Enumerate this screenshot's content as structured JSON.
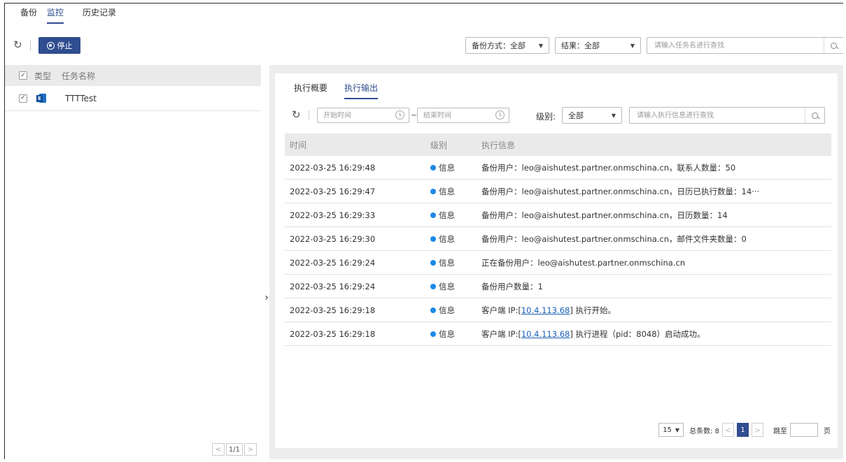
{
  "top_nav": {
    "tabs": [
      "备份",
      "监控",
      "历史记录"
    ],
    "active": "监控"
  },
  "toolbar": {
    "stop_label": "停止",
    "backup_method_filter": "备份方式：全部",
    "result_filter": "结果：全部",
    "task_search_placeholder": "请输入任务名进行查找"
  },
  "task_list": {
    "headers": {
      "type": "类型",
      "name": "任务名称"
    },
    "items": [
      {
        "name": "TTTTest",
        "type_icon": "outlook-icon",
        "checked": true
      }
    ],
    "pagination": {
      "page_text": "1/1"
    }
  },
  "detail": {
    "tabs": [
      "执行概要",
      "执行输出"
    ],
    "active_tab": "执行输出",
    "filters": {
      "start_placeholder": "开始时间",
      "end_placeholder": "结束时间",
      "tilde": "~",
      "level_label": "级别:",
      "level_value": "全部",
      "search_placeholder": "请输入执行信息进行查找"
    },
    "table": {
      "headers": [
        "时间",
        "级别",
        "执行信息"
      ],
      "rows": [
        {
          "time": "2022-03-25 16:29:48",
          "level": "信息",
          "msg": "备份用户：leo@aishutest.partner.onmschina.cn，联系人数量：50"
        },
        {
          "time": "2022-03-25 16:29:47",
          "level": "信息",
          "msg": "备份用户：leo@aishutest.partner.onmschina.cn，日历已执行数量：14···"
        },
        {
          "time": "2022-03-25 16:29:33",
          "level": "信息",
          "msg": "备份用户：leo@aishutest.partner.onmschina.cn，日历数量：14"
        },
        {
          "time": "2022-03-25 16:29:30",
          "level": "信息",
          "msg": "备份用户：leo@aishutest.partner.onmschina.cn，邮件文件夹数量：0"
        },
        {
          "time": "2022-03-25 16:29:24",
          "level": "信息",
          "msg": "正在备份用户：leo@aishutest.partner.onmschina.cn"
        },
        {
          "time": "2022-03-25 16:29:24",
          "level": "信息",
          "msg": "备份用户数量：1"
        },
        {
          "time": "2022-03-25 16:29:18",
          "level": "信息",
          "msg_pre": "客户端 IP:[",
          "msg_link": "10.4.113.68",
          "msg_post": "] 执行开始。"
        },
        {
          "time": "2022-03-25 16:29:18",
          "level": "信息",
          "msg_pre": "客户端 IP:[",
          "msg_link": "10.4.113.68",
          "msg_post": "] 执行进程（pid：8048）启动成功。"
        }
      ]
    },
    "pagination": {
      "page_size": "15",
      "total_label": "总条数: 8",
      "current_page": "1",
      "jump_label": "跳至",
      "page_unit": "页"
    }
  },
  "colors": {
    "accent": "#2f4d8f",
    "info_dot": "#1e88e5",
    "link": "#1a5fb4"
  }
}
